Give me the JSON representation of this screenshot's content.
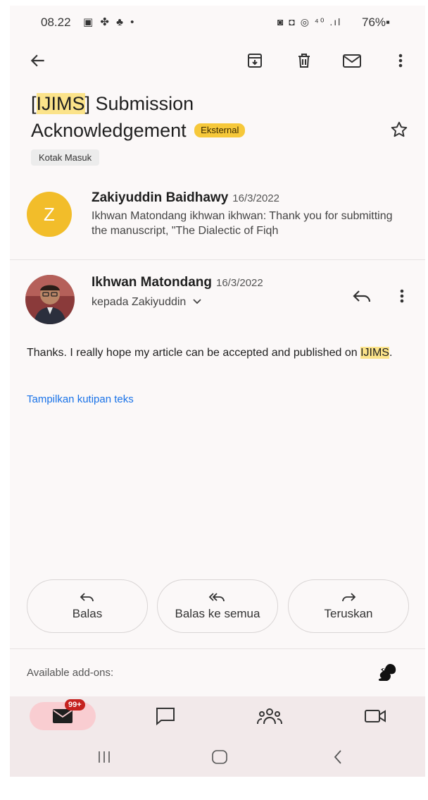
{
  "status_bar": {
    "time": "08.22",
    "left_icons": "▣ ✤ ♣ •",
    "right_icons": "◙ ◘ ◎ ⁴⁰ .ıl",
    "battery": "76%▪"
  },
  "toolbar": {
    "icons": [
      "back-arrow-icon",
      "archive-icon",
      "trash-icon",
      "mark-unread-icon",
      "more-vert-icon"
    ]
  },
  "subject": {
    "bracket_open": "[",
    "highlight": "IJIMS",
    "rest_line1": "] Submission",
    "line2": "Acknowledgement",
    "badge": "Eksternal"
  },
  "label_chip": "Kotak Masuk",
  "messages": [
    {
      "avatar_letter": "Z",
      "sender": "Zakiyuddin Baidhawy",
      "date": "16/3/2022",
      "snippet": "Ikhwan Matondang ikhwan ikhwan: Thank you for submitting the manuscript, \"The Dialectic of Fiqh"
    },
    {
      "sender": "Ikhwan Matondang",
      "date": "16/3/2022",
      "recipient": "kepada Zakiyuddin"
    }
  ],
  "body": {
    "text_before": "Thanks. I really hope my article can be accepted and published on ",
    "highlight": "IJIMS",
    "text_after": ".",
    "quote_link": "Tampilkan kutipan teks"
  },
  "actions": {
    "reply": "Balas",
    "reply_all": "Balas ke semua",
    "forward": "Teruskan"
  },
  "addons_label": "Available add-ons:",
  "bottom_nav": {
    "mail_badge": "99+"
  },
  "colors": {
    "accent_blue": "#1a73e8",
    "highlight_yellow": "#fbe38a",
    "avatar_yellow": "#f2bd2a",
    "badge_red": "#c5221f",
    "nav_active": "#f9cdd1"
  }
}
